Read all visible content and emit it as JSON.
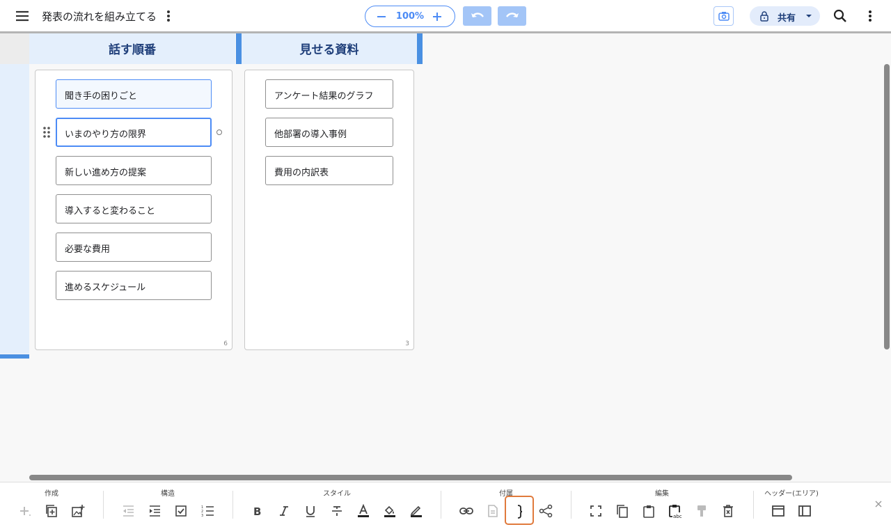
{
  "header": {
    "title": "発表の流れを組み立てる",
    "zoom": "100%",
    "share_label": "共有"
  },
  "board": {
    "columns": [
      {
        "title": "話す順番",
        "count": "6",
        "cards": [
          "聞き手の困りごと",
          "いまのやり方の限界",
          "新しい進め方の提案",
          "導入すると変わること",
          "必要な費用",
          "進めるスケジュール"
        ]
      },
      {
        "title": "見せる資料",
        "count": "3",
        "cards": [
          "アンケート結果のグラフ",
          "他部署の導入事例",
          "費用の内訳表"
        ]
      }
    ]
  },
  "toolbar": {
    "groups": [
      "作成",
      "構造",
      "スタイル",
      "付属",
      "編集",
      "ヘッダー(エリア)"
    ]
  },
  "colors": {
    "accent": "#4c8bf5",
    "header_bg": "#e4effc",
    "divider": "#4a90e2",
    "header_text": "#1f3f7a",
    "highlight": "#e07a3c"
  }
}
